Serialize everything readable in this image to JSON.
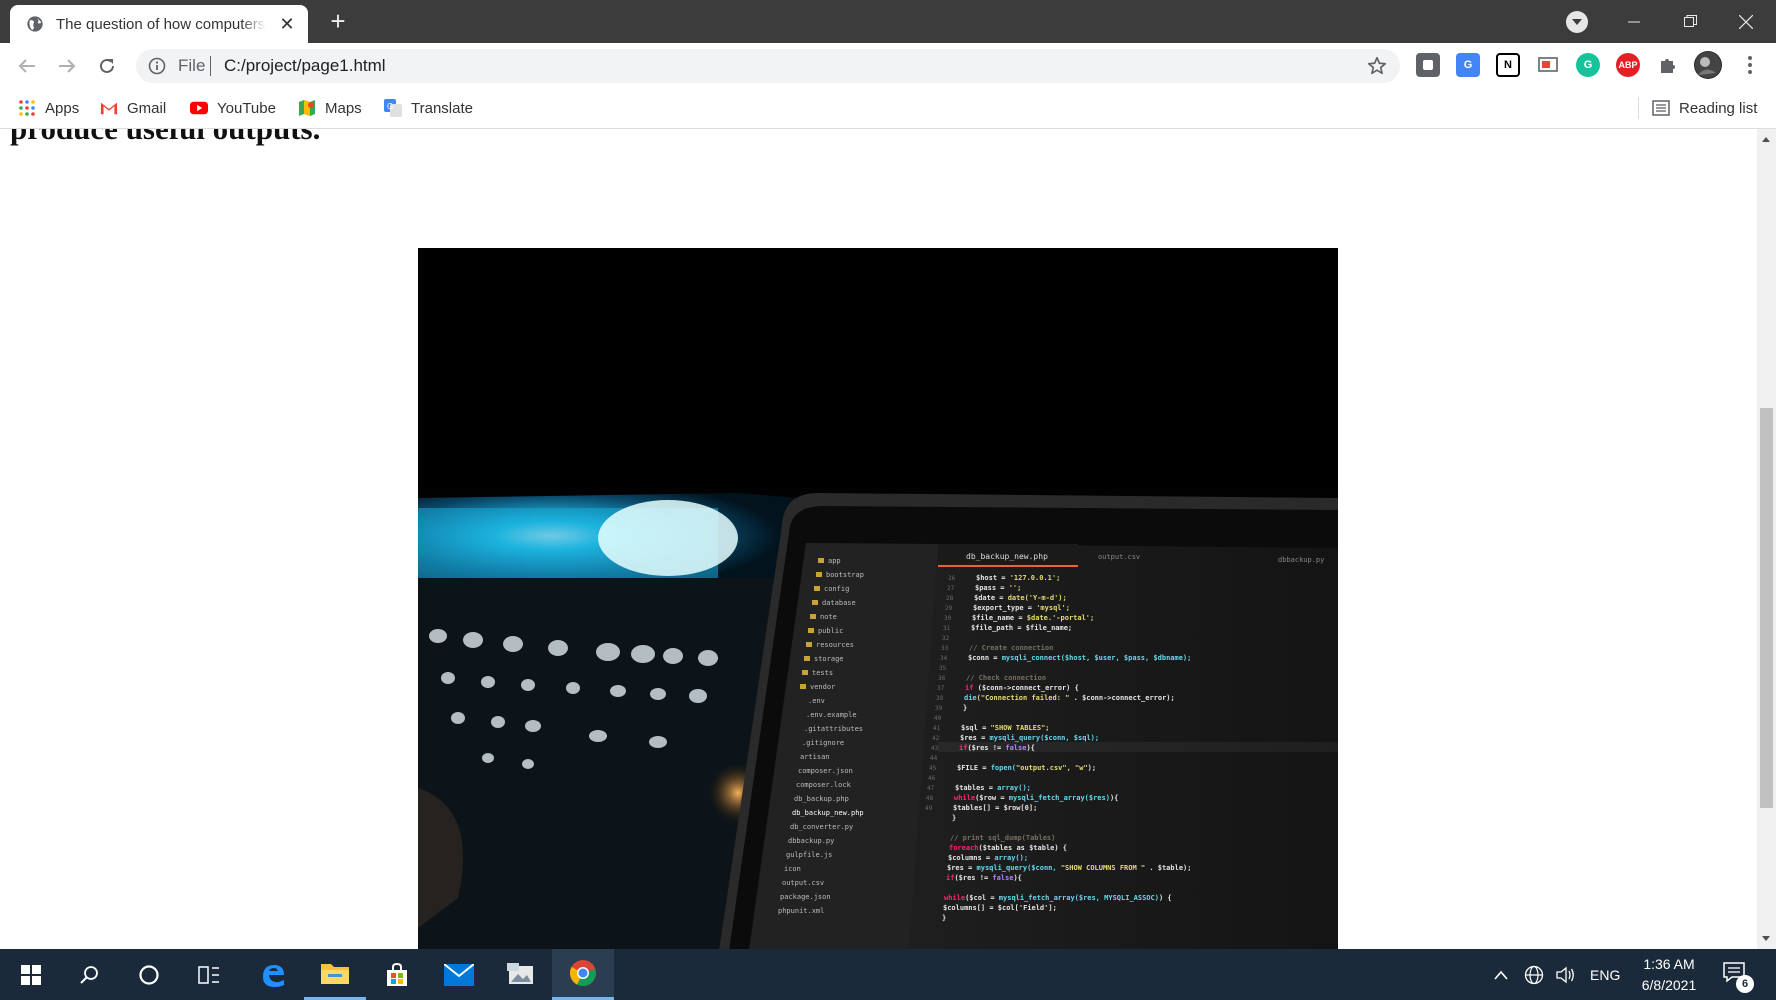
{
  "browser": {
    "tab": {
      "title": "The question of how computers can",
      "close_label": "✕"
    },
    "new_tab_label": "+",
    "omnibox": {
      "scheme": "File",
      "url": "C:/project/page1.html"
    },
    "reading_list_label": "Reading list"
  },
  "bookmarks": [
    {
      "label": "Apps",
      "icon": "apps-grid-icon"
    },
    {
      "label": "Gmail",
      "icon": "gmail-icon"
    },
    {
      "label": "YouTube",
      "icon": "youtube-icon"
    },
    {
      "label": "Maps",
      "icon": "maps-icon"
    },
    {
      "label": "Translate",
      "icon": "translate-icon"
    }
  ],
  "extensions": [
    {
      "name": "extension-icon",
      "text": ""
    },
    {
      "name": "google-translate-extension-icon",
      "text": "G"
    },
    {
      "name": "notion-extension-icon",
      "text": "N"
    },
    {
      "name": "cast-extension-icon",
      "text": ""
    },
    {
      "name": "grammarly-extension-icon",
      "text": "G"
    },
    {
      "name": "adblock-plus-extension-icon",
      "text": "ABP"
    }
  ],
  "page": {
    "heading_fragment": "produce useful outputs.",
    "image_alt": "Laptop showing code editor in dark room"
  },
  "taskbar": {
    "tray_language": "ENG",
    "time": "1:36 AM",
    "date": "6/8/2021",
    "notifications_count": "6"
  },
  "colors": {
    "titlebar": "#3c3c3c",
    "taskbar": "#1b2a3a",
    "accent": "#77b5ea"
  }
}
